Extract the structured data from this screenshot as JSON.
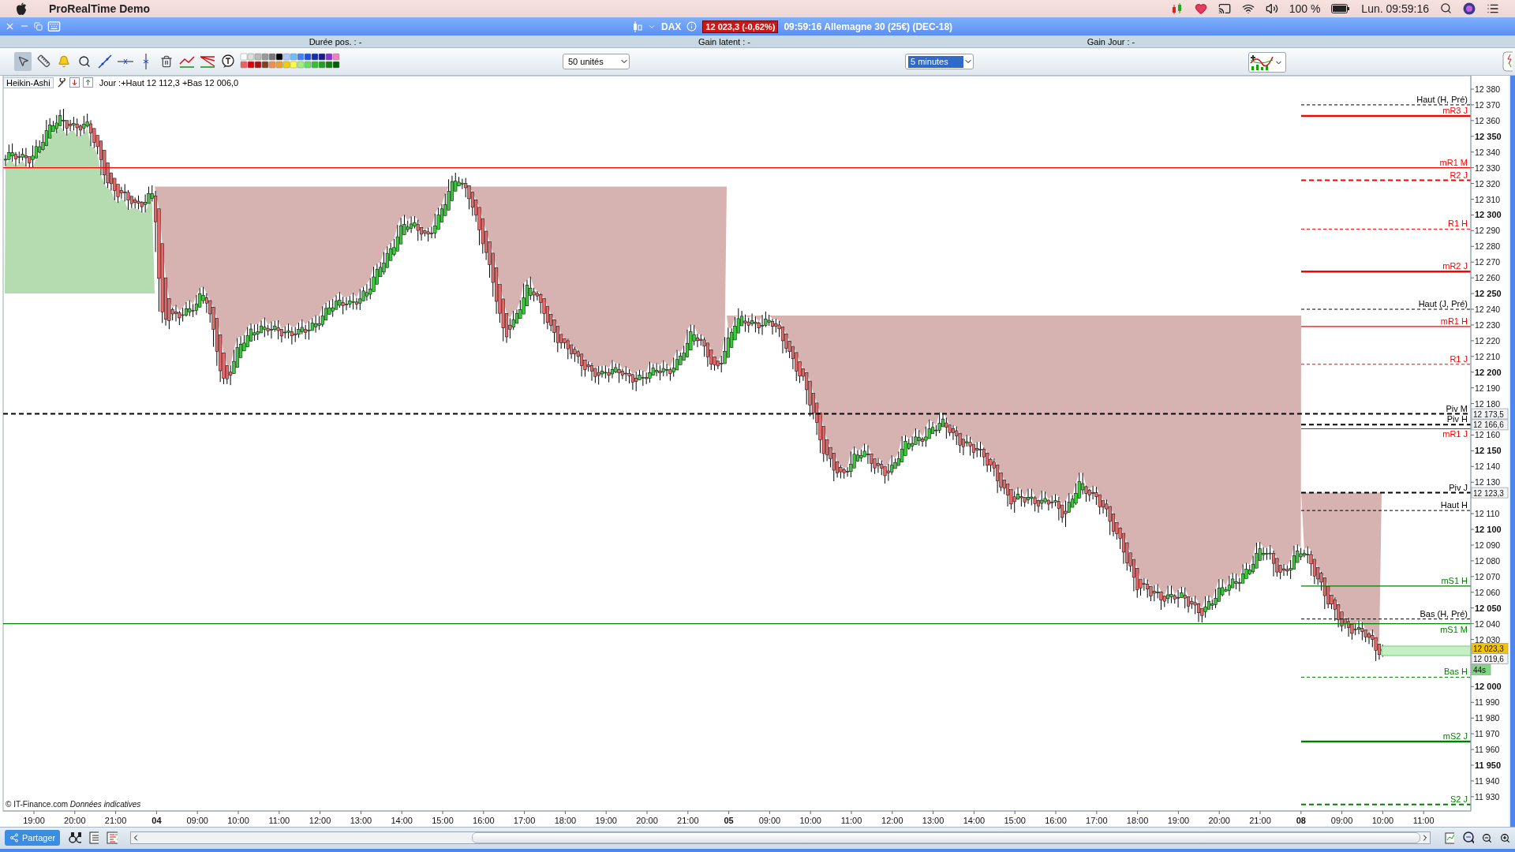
{
  "menubar": {
    "app": "ProRealTime Demo",
    "battery": "100 %",
    "clock": "Lun. 09:59:16"
  },
  "window": {
    "instrument": "DAX",
    "price_badge": "12 023,3 (-0,62%)",
    "title": "09:59:16 Allemagne 30 (25€) (DEC-18)"
  },
  "info_bar": [
    "Durée pos. : -",
    "Gain latent : -",
    "Gain Jour : -"
  ],
  "toolbar": {
    "quantity": "50 unités",
    "timeframe": "5 minutes"
  },
  "chart": {
    "style": "Heikin-Ashi",
    "summary": "Jour :+Haut 12 112,3 +Bas 12 006,0",
    "levels": [
      {
        "label": "Haut (H, Pré)",
        "color": "#000000",
        "kind": "dashed"
      },
      {
        "label": "mR3 J",
        "color": "#ff0000",
        "kind": "thick"
      },
      {
        "label": "mR1 M",
        "color": "#ff0000",
        "kind": "solid"
      },
      {
        "label": "R2 J",
        "color": "#ff0000",
        "kind": "bold-dashed"
      },
      {
        "label": "R1 H",
        "color": "#ff0000",
        "kind": "dashed"
      },
      {
        "label": "mR2 J",
        "color": "#ff0000",
        "kind": "thick"
      },
      {
        "label": "Haut (J, Pré)",
        "color": "#000000",
        "kind": "dashed"
      },
      {
        "label": "mR1 H",
        "color": "#ff0000",
        "kind": "solid"
      },
      {
        "label": "R1 J",
        "color": "#ff0000",
        "kind": "dashed"
      },
      {
        "label": "Piv M",
        "color": "#000000",
        "kind": "bold-dashed"
      },
      {
        "label": "Piv H",
        "color": "#000000",
        "kind": "bold-dashed"
      },
      {
        "label": "mR1 J",
        "color": "#ff0000",
        "kind": "solid"
      },
      {
        "label": "Piv J",
        "color": "#000000",
        "kind": "bold-dashed"
      },
      {
        "label": "Haut H",
        "color": "#000000",
        "kind": "dashed"
      },
      {
        "label": "mS1 H",
        "color": "#008000",
        "kind": "solid"
      },
      {
        "label": "Bas (H, Pré)",
        "color": "#000000",
        "kind": "dashed"
      },
      {
        "label": "mS1 M",
        "color": "#008000",
        "kind": "solid"
      },
      {
        "label": "Bas H",
        "color": "#008000",
        "kind": "dashed"
      },
      {
        "label": "mS2 J",
        "color": "#008000",
        "kind": "thick"
      },
      {
        "label": "S2 J",
        "color": "#008000",
        "kind": "bold-dashed"
      }
    ],
    "price_ticks": [
      {
        "label": "12 380",
        "major": false
      },
      {
        "label": "12 370",
        "major": false
      },
      {
        "label": "12 360",
        "major": false
      },
      {
        "label": "12 350",
        "major": true
      },
      {
        "label": "12 340",
        "major": false
      },
      {
        "label": "12 330",
        "major": false
      },
      {
        "label": "12 320",
        "major": false
      },
      {
        "label": "12 310",
        "major": false
      },
      {
        "label": "12 300",
        "major": true
      },
      {
        "label": "12 290",
        "major": false
      },
      {
        "label": "12 280",
        "major": false
      },
      {
        "label": "12 270",
        "major": false
      },
      {
        "label": "12 260",
        "major": false
      },
      {
        "label": "12 250",
        "major": true
      },
      {
        "label": "12 240",
        "major": false
      },
      {
        "label": "12 230",
        "major": false
      },
      {
        "label": "12 220",
        "major": false
      },
      {
        "label": "12 210",
        "major": false
      },
      {
        "label": "12 200",
        "major": true
      },
      {
        "label": "12 190",
        "major": false
      },
      {
        "label": "12 180",
        "major": false
      },
      {
        "label": "12 160",
        "major": false
      },
      {
        "label": "12 150",
        "major": true
      },
      {
        "label": "12 140",
        "major": false
      },
      {
        "label": "12 130",
        "major": false
      },
      {
        "label": "12 110",
        "major": false
      },
      {
        "label": "12 100",
        "major": true
      },
      {
        "label": "12 090",
        "major": false
      },
      {
        "label": "12 080",
        "major": false
      },
      {
        "label": "12 070",
        "major": false
      },
      {
        "label": "12 060",
        "major": false
      },
      {
        "label": "12 050",
        "major": true
      },
      {
        "label": "12 040",
        "major": false
      },
      {
        "label": "12 030",
        "major": false
      },
      {
        "label": "12 000",
        "major": true
      },
      {
        "label": "11 990",
        "major": false
      },
      {
        "label": "11 980",
        "major": false
      },
      {
        "label": "11 970",
        "major": false
      },
      {
        "label": "11 960",
        "major": false
      },
      {
        "label": "11 950",
        "major": true
      },
      {
        "label": "11 940",
        "major": false
      },
      {
        "label": "11 930",
        "major": false
      }
    ],
    "price_tags": [
      {
        "text": "12 173,5",
        "kind": "level"
      },
      {
        "text": "12 166,6",
        "kind": "level"
      },
      {
        "text": "12 123,3",
        "kind": "level"
      },
      {
        "text": "12 023,3",
        "kind": "last"
      },
      {
        "text": "12 019,6",
        "kind": "level"
      },
      {
        "text": "44s",
        "kind": "timer"
      }
    ],
    "time_ticks": [
      {
        "label": "19:00",
        "major": false
      },
      {
        "label": "20:00",
        "major": false
      },
      {
        "label": "21:00",
        "major": false
      },
      {
        "label": "04",
        "major": true
      },
      {
        "label": "09:00",
        "major": false
      },
      {
        "label": "10:00",
        "major": false
      },
      {
        "label": "11:00",
        "major": false
      },
      {
        "label": "12:00",
        "major": false
      },
      {
        "label": "13:00",
        "major": false
      },
      {
        "label": "14:00",
        "major": false
      },
      {
        "label": "15:00",
        "major": false
      },
      {
        "label": "16:00",
        "major": false
      },
      {
        "label": "17:00",
        "major": false
      },
      {
        "label": "18:00",
        "major": false
      },
      {
        "label": "19:00",
        "major": false
      },
      {
        "label": "20:00",
        "major": false
      },
      {
        "label": "21:00",
        "major": false
      },
      {
        "label": "05",
        "major": true
      },
      {
        "label": "09:00",
        "major": false
      },
      {
        "label": "10:00",
        "major": false
      },
      {
        "label": "11:00",
        "major": false
      },
      {
        "label": "12:00",
        "major": false
      },
      {
        "label": "13:00",
        "major": false
      },
      {
        "label": "14:00",
        "major": false
      },
      {
        "label": "15:00",
        "major": false
      },
      {
        "label": "16:00",
        "major": false
      },
      {
        "label": "17:00",
        "major": false
      },
      {
        "label": "18:00",
        "major": false
      },
      {
        "label": "19:00",
        "major": false
      },
      {
        "label": "20:00",
        "major": false
      },
      {
        "label": "21:00",
        "major": false
      },
      {
        "label": "08",
        "major": true
      },
      {
        "label": "09:00",
        "major": false
      },
      {
        "label": "10:00",
        "major": false
      },
      {
        "label": "11:00",
        "major": false
      }
    ],
    "source": "© IT-Finance.com",
    "disclaimer": "Données indicatives"
  },
  "bottom_bar": {
    "share": "Partager"
  }
}
